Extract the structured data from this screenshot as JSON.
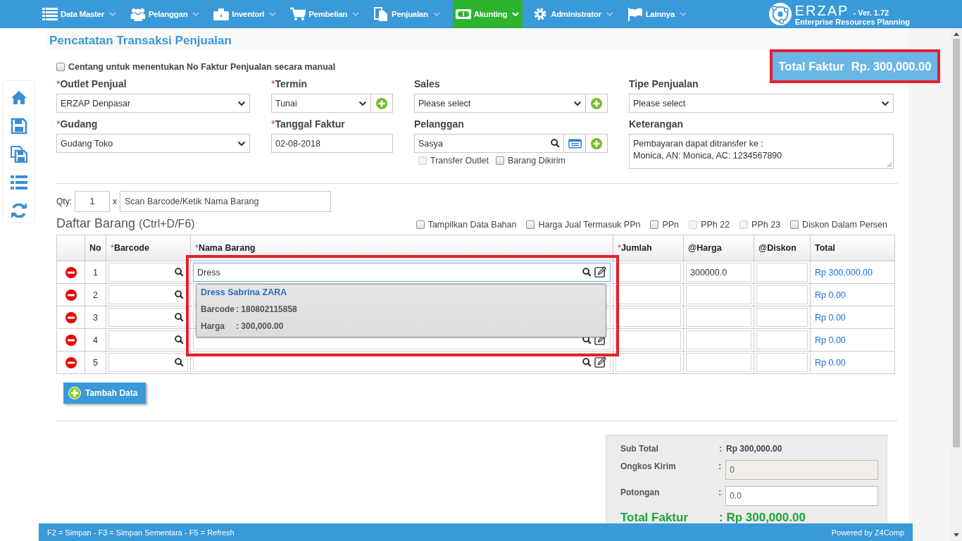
{
  "nav": {
    "items": [
      {
        "label": "Data Master",
        "selected": false
      },
      {
        "label": "Pelanggan",
        "selected": false
      },
      {
        "label": "Inventori",
        "selected": false
      },
      {
        "label": "Pembelian",
        "selected": false
      },
      {
        "label": "Penjualan",
        "selected": false
      },
      {
        "label": "Akunting",
        "selected": true
      },
      {
        "label": "Administrator",
        "selected": false
      },
      {
        "label": "Lainnya",
        "selected": false
      }
    ],
    "brand": {
      "name": "ERZAP",
      "version": "- Ver. 1.72",
      "tagline": "Enterprise Resources Planning"
    }
  },
  "page_title": "Pencatatan Transaksi Penjualan",
  "total_banner": {
    "label": "Total Faktur",
    "value": "Rp. 300,000.00",
    "highlighted": true
  },
  "manual_checkbox": {
    "label": "Centang untuk menentukan No Faktur Penjualan secara manual",
    "checked": false
  },
  "fields": [
    {
      "required_mark": "*",
      "label": "Outlet Penjual",
      "kind": "select",
      "value": "ERZAP Denpasar",
      "add_button": false
    },
    {
      "required_mark": "*",
      "label": "Termin",
      "kind": "select",
      "value": "Tunai",
      "add_button": true
    },
    {
      "label": "Sales",
      "kind": "select",
      "value": "Please select",
      "add_button": true
    },
    {
      "label": "Tipe Penjualan",
      "kind": "select",
      "value": "Please select",
      "add_button": false
    },
    {
      "required_mark": "*",
      "label": "Gudang",
      "kind": "select",
      "value": "Gudang Toko",
      "add_button": false
    },
    {
      "required_mark": "*",
      "label": "Tanggal Faktur",
      "kind": "text",
      "value": "02-08-2018"
    },
    {
      "label": "Pelanggan",
      "kind": "search",
      "value": "Sasya",
      "options": [
        {
          "label": "Transfer Outlet",
          "checked": false,
          "disabled": true
        },
        {
          "label": "Barang Dikirim",
          "checked": false,
          "disabled": false
        }
      ]
    },
    {
      "label": "Keterangan",
      "kind": "textarea",
      "value": "Pembayaran dapat ditransfer ke :\nMonica, AN: Monica, AC: 1234567890"
    }
  ],
  "scan": {
    "qty_label": "Qty:",
    "qty": "1",
    "times": "x",
    "placeholder": "Scan Barcode/Ketik Nama Barang"
  },
  "items_title": "Daftar Barang",
  "items_shortcut": "(Ctrl+D/F6)",
  "options": [
    {
      "label": "Tampilkan Data Bahan",
      "checked": false,
      "disabled": false
    },
    {
      "label": "Harga Jual Termasuk PPn",
      "checked": false,
      "disabled": false
    },
    {
      "label": "PPn",
      "checked": false,
      "disabled": false
    },
    {
      "label": "PPh 22",
      "checked": false,
      "disabled": true
    },
    {
      "label": "PPh 23",
      "checked": false,
      "disabled": true
    },
    {
      "label": "Diskon Dalam Persen",
      "checked": false,
      "disabled": false
    }
  ],
  "table": {
    "columns": [
      {
        "label": "No"
      },
      {
        "required_mark": "*",
        "label": "Barcode"
      },
      {
        "required_mark": "*",
        "label": "Nama Barang"
      },
      {
        "required_mark": "*",
        "label": "Jumlah"
      },
      {
        "label": "@Harga"
      },
      {
        "label": "@Diskon"
      },
      {
        "label": "Total"
      }
    ],
    "rows": [
      {
        "no": "1",
        "name": "Dress",
        "harga": "300000.0",
        "total": "Rp 300,000.00"
      },
      {
        "no": "2",
        "total": "Rp 0.00"
      },
      {
        "no": "3",
        "total": "Rp 0.00"
      },
      {
        "no": "4",
        "total": "Rp 0.00"
      },
      {
        "no": "5",
        "total": "Rp 0.00"
      }
    ]
  },
  "autocomplete": {
    "title": "Dress Sabrina ZARA",
    "highlighted": true,
    "lines": [
      {
        "label": "Barcode",
        "value": ": 180802115858"
      },
      {
        "label": "Harga",
        "value": ": 300,000.00"
      }
    ]
  },
  "add_button": "Tambah Data",
  "summary": {
    "rows": [
      {
        "label": "Sub Total",
        "sep": ":",
        "kind": "text",
        "value": "Rp 300,000.00"
      },
      {
        "label": "Ongkos Kirim",
        "sep": ":",
        "kind": "input",
        "value": "0",
        "readonly": true
      },
      {
        "label": "Potongan",
        "sep": ":",
        "kind": "input",
        "value": "0.0",
        "readonly": false
      }
    ],
    "total_label": "Total Faktur",
    "total_value": ": Rp 300,000.00"
  },
  "footer": {
    "shortcuts": "F2 = Simpan - F3 = Simpan Sementara - F5 = Refresh",
    "powered_by": "Powered by Z4Comp"
  }
}
